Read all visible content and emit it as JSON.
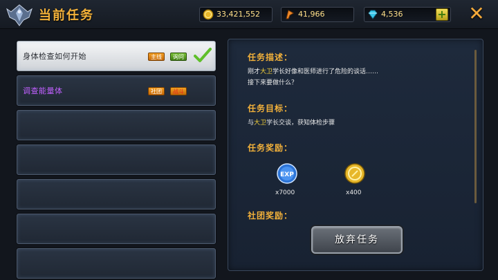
{
  "header": {
    "title": "当前任务",
    "gold": "33,421,552",
    "stamina": "41,966",
    "gems": "4,536",
    "close_glyph": "✕"
  },
  "tasks": [
    {
      "name": "身体检查如何开始",
      "tags": [
        "主线",
        "询问"
      ],
      "completed": true,
      "active": true
    },
    {
      "name": "调查能量体",
      "tags": [
        "社团",
        "战斗"
      ],
      "completed": false,
      "active": false
    },
    {
      "name": "",
      "tags": []
    },
    {
      "name": "",
      "tags": []
    },
    {
      "name": "",
      "tags": []
    },
    {
      "name": "",
      "tags": []
    },
    {
      "name": "",
      "tags": []
    }
  ],
  "detail": {
    "desc_title": "任务描述：",
    "desc_line1_pre": "刚才",
    "desc_line1_hl": "大卫",
    "desc_line1_post": "学长好像和医师进行了危险的谈话……",
    "desc_line2": "接下来要做什么？",
    "goal_title": "任务目标：",
    "goal_pre": "与",
    "goal_hl": "大卫",
    "goal_post": "学长交谈，获知体检步骤",
    "reward_title": "任务奖励：",
    "rewards": [
      {
        "icon": "exp-icon",
        "label": "EXP",
        "amount": "x7000"
      },
      {
        "icon": "gold-coin-icon",
        "amount": "x400"
      }
    ],
    "club_reward_title": "社团奖励：",
    "abandon_label": "放弃任务"
  },
  "colors": {
    "accent": "#f4b23a",
    "highlight": "#f4d03a",
    "purple_task": "#c060ff"
  }
}
